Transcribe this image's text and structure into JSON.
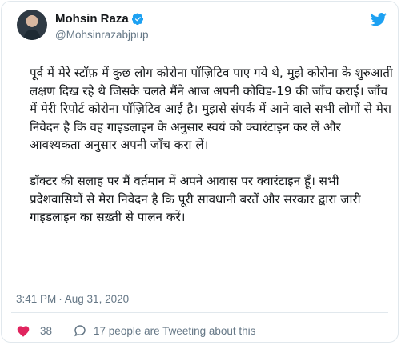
{
  "user": {
    "name": "Mohsin Raza",
    "handle": "@Mohsinrazabjpup"
  },
  "tweet": {
    "para1": "पूर्व में मेरे स्टॉफ़ में कुछ लोग कोरोना पॉज़िटिव पाए गये थे, मुझे कोरोना के शुरुआती लक्षण दिख रहे थे जिसके चलते मैंने आज अपनी कोविड-19 की जाँच कराई। जाँच में मेरी रिपोर्ट कोरोना पॉज़िटिव आई है। मुझसे संपर्क में आने वाले सभी लोगों से मेरा निवेदन है कि वह गाइडलाइन के अनुसार स्वयं को क्वारंटाइन कर लें और आवश्यकता अनुसार अपनी जाँच करा लें।",
    "para2": "डॉक्टर की सलाह पर मैं वर्तमान में अपने आवास पर क्वारंटाइन हूँ। सभी प्रदेशवासियों से मेरा निवेदन है कि पूरी सावधानी बरतें और सरकार द्वारा जारी गाइडलाइन का सख़्ती से पालन करें।"
  },
  "meta": {
    "time": "3:41 PM",
    "separator": "·",
    "date": "Aug 31, 2020"
  },
  "actions": {
    "likes": "38",
    "talking": "17 people are Tweeting about this"
  },
  "colors": {
    "accent": "#1da1f2",
    "heart": "#e0245e",
    "secondary_text": "#657786"
  },
  "icons": [
    "verified-badge-icon",
    "twitter-bird-icon",
    "heart-icon",
    "reply-bubble-icon"
  ]
}
